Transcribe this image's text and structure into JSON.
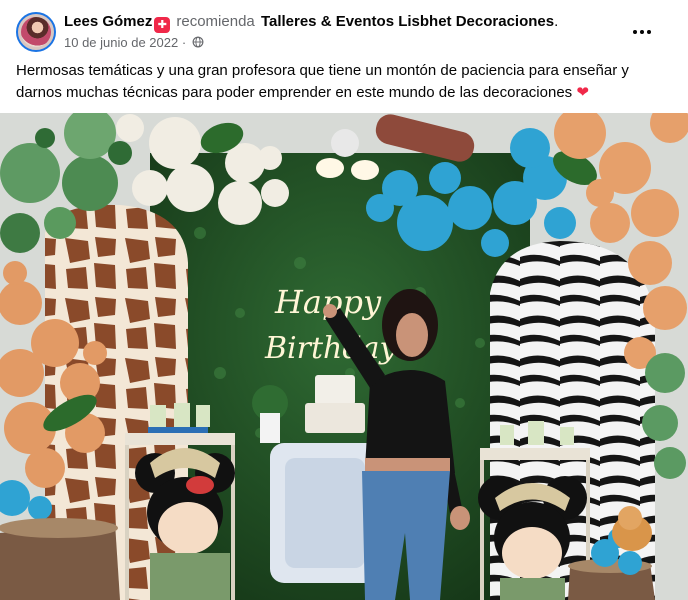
{
  "post": {
    "author_name": "Lees Gómez",
    "recommends_text": "recomienda",
    "page_name": "Talleres & Eventos Lisbhet Decoraciones",
    "end_punct": ".",
    "date": "10 de junio de 2022",
    "separator": "·",
    "text": "Hermosas temáticas y una gran profesora que tiene un montón de paciencia para enseñar y darnos muchas técnicas para poder emprender en este  mundo de las decoraciones",
    "heart_emoji": "❤",
    "photo": {
      "neon_line1": "Happy",
      "neon_line2": "Birthday"
    }
  },
  "colors": {
    "accent": "#1b74e4",
    "badge": "#f02849",
    "secondary_text": "#65676b"
  },
  "icons": [
    "globe-icon",
    "more-options-icon",
    "recommend-badge-icon"
  ]
}
